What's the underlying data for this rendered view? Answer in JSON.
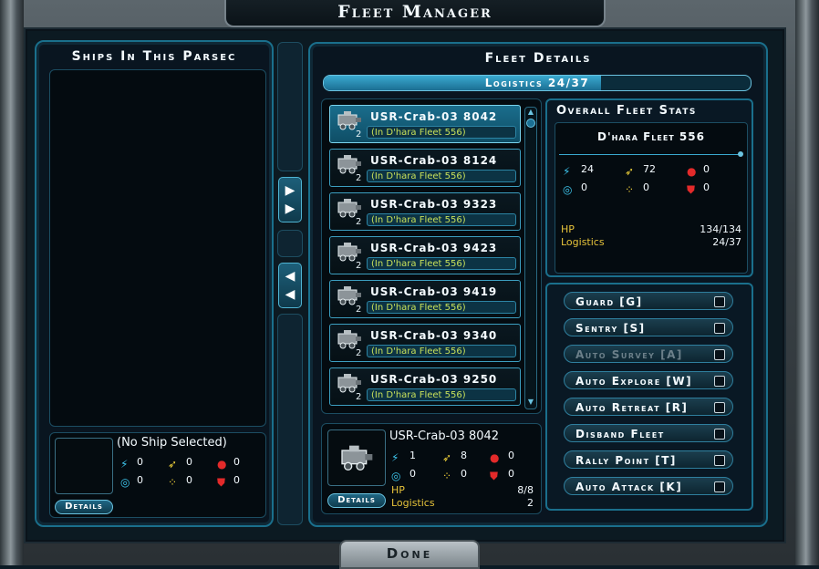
{
  "window": {
    "title": "Fleet Manager"
  },
  "left_panel": {
    "title": "Ships In This Parsec",
    "selected": {
      "name": "(No Ship Selected)",
      "stats": {
        "beam": "0",
        "missile": "0",
        "rocket": "0",
        "shield": "0",
        "scatter": "0",
        "armor": "0"
      },
      "details_label": "Details"
    }
  },
  "transfer": {
    "add_icon": "double-right-arrow-icon",
    "remove_icon": "double-left-arrow-icon"
  },
  "fleet_details": {
    "title": "Fleet Details",
    "logistics_label": "Logistics 24/37",
    "logistics_fraction": 0.6486,
    "ships": [
      {
        "name": "USR-Crab-03 8042",
        "count": "2",
        "fleet": "(In D'hara Fleet 556)",
        "selected": true
      },
      {
        "name": "USR-Crab-03 8124",
        "count": "2",
        "fleet": "(In D'hara Fleet 556)",
        "selected": false
      },
      {
        "name": "USR-Crab-03 9323",
        "count": "2",
        "fleet": "(In D'hara Fleet 556)",
        "selected": false
      },
      {
        "name": "USR-Crab-03 9423",
        "count": "2",
        "fleet": "(In D'hara Fleet 556)",
        "selected": false
      },
      {
        "name": "USR-Crab-03 9419",
        "count": "2",
        "fleet": "(In D'hara Fleet 556)",
        "selected": false
      },
      {
        "name": "USR-Crab-03 9340",
        "count": "2",
        "fleet": "(In D'hara Fleet 556)",
        "selected": false
      },
      {
        "name": "USR-Crab-03 9250",
        "count": "2",
        "fleet": "(In D'hara Fleet 556)",
        "selected": false
      }
    ],
    "selected_ship": {
      "name": "USR-Crab-03 8042",
      "stats": {
        "beam": "1",
        "missile": "8",
        "rocket": "0",
        "shield": "0",
        "scatter": "0",
        "armor": "0"
      },
      "hp_label": "HP",
      "hp_value": "8/8",
      "logistics_label": "Logistics",
      "logistics_value": "2",
      "details_label": "Details"
    }
  },
  "overall": {
    "title": "Overall Fleet Stats",
    "fleet_name": "D'hara Fleet 556",
    "stats": {
      "beam": "24",
      "missile": "72",
      "rocket": "0",
      "shield": "0",
      "scatter": "0",
      "armor": "0"
    },
    "hp_label": "HP",
    "hp_value": "134/134",
    "logistics_label": "Logistics",
    "logistics_value": "24/37"
  },
  "commands": [
    {
      "label": "Guard [G]",
      "enabled": true
    },
    {
      "label": "Sentry [S]",
      "enabled": true
    },
    {
      "label": "Auto Survey [A]",
      "enabled": false
    },
    {
      "label": "Auto Explore [W]",
      "enabled": true
    },
    {
      "label": "Auto Retreat [R]",
      "enabled": true
    },
    {
      "label": "Disband Fleet",
      "enabled": true
    },
    {
      "label": "Rally Point [T]",
      "enabled": true
    },
    {
      "label": "Auto Attack [K]",
      "enabled": true
    }
  ],
  "footer": {
    "done_label": "Done"
  },
  "colors": {
    "accent": "#1a6f8c",
    "highlight": "#3aa9d0",
    "fleet_text": "#c8e05a",
    "gold": "#e6c33a"
  }
}
